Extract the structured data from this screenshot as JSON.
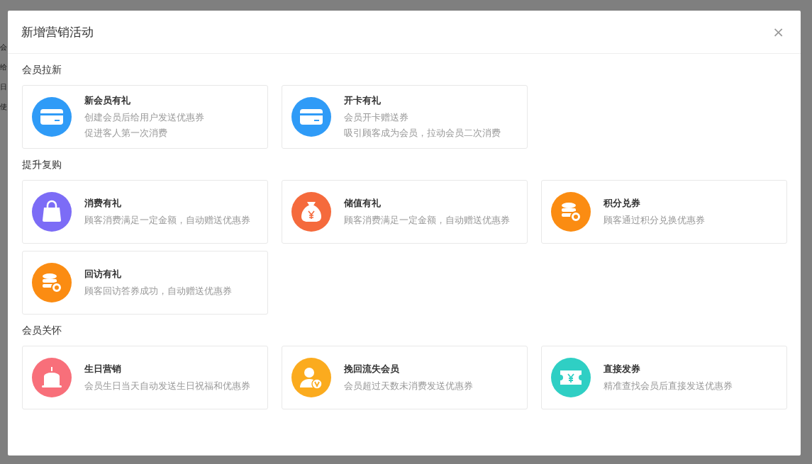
{
  "background_labels": [
    "会",
    "给",
    "日",
    "使"
  ],
  "dialog": {
    "title": "新增营销活动",
    "close": "×"
  },
  "sections": [
    {
      "title": "会员拉新",
      "cards": [
        {
          "title": "新会员有礼",
          "lines": [
            "创建会员后给用户发送优惠券",
            "促进客人第一次消费"
          ],
          "kind": "card",
          "color": "#2f9bf7"
        },
        {
          "title": "开卡有礼",
          "lines": [
            "会员开卡赠送券",
            "吸引顾客成为会员，拉动会员二次消费"
          ],
          "kind": "card",
          "color": "#2f9bf7"
        }
      ]
    },
    {
      "title": "提升复购",
      "cards": [
        {
          "title": "消费有礼",
          "lines": [
            "顾客消费满足一定金额，自动赠送优惠券"
          ],
          "kind": "bag",
          "color": "#7c6cf6"
        },
        {
          "title": "储值有礼",
          "lines": [
            "顾客消费满足一定金额，自动赠送优惠券"
          ],
          "kind": "moneybag",
          "color": "#f56a3c"
        },
        {
          "title": "积分兑券",
          "lines": [
            "顾客通过积分兑换优惠券"
          ],
          "kind": "coins",
          "color": "#fb8c12"
        },
        {
          "title": "回访有礼",
          "lines": [
            "顾客回访答券成功，自动赠送优惠券"
          ],
          "kind": "coins",
          "color": "#fb8c12"
        }
      ]
    },
    {
      "title": "会员关怀",
      "cards": [
        {
          "title": "生日营销",
          "lines": [
            "会员生日当天自动发送生日祝福和优惠券"
          ],
          "kind": "cake",
          "color": "#f86f7a"
        },
        {
          "title": "挽回流失会员",
          "lines": [
            "会员超过天数未消费发送优惠券"
          ],
          "kind": "user",
          "color": "#fbab1e"
        },
        {
          "title": "直接发券",
          "lines": [
            "精准查找会员后直接发送优惠券"
          ],
          "kind": "ticket",
          "color": "#2fcfc4"
        }
      ]
    }
  ]
}
